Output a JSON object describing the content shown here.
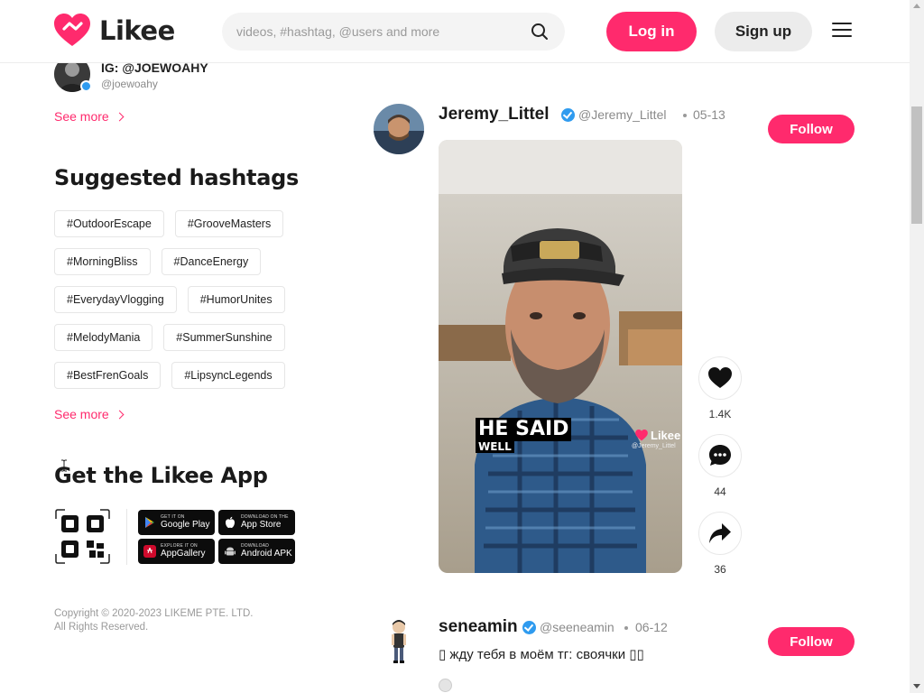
{
  "app": {
    "name": "Likee",
    "brand_color": "#ff2a6d"
  },
  "header": {
    "search_placeholder": "videos, #hashtag, @users and more",
    "login_label": "Log in",
    "signup_label": "Sign up"
  },
  "sidebar": {
    "account": {
      "name": "IG: @JOEWOAHY",
      "handle": "@joewoahy"
    },
    "see_more_1": "See more",
    "hashtags_title": "Suggested hashtags",
    "hashtags": [
      [
        "#OutdoorEscape",
        "#GrooveMasters"
      ],
      [
        "#MorningBliss",
        "#DanceEnergy"
      ],
      [
        "#EverydayVlogging",
        "#HumorUnites"
      ],
      [
        "#MelodyMania",
        "#SummerSunshine"
      ],
      [
        "#BestFrenGoals",
        "#LipsyncLegends"
      ]
    ],
    "see_more_2": "See more",
    "app_title": "Get the Likee App",
    "stores": [
      {
        "small": "GET IT ON",
        "big": "Google Play",
        "icon": "play-icon"
      },
      {
        "small": "DOWNLOAD ON THE",
        "big": "App Store",
        "icon": "apple-icon"
      },
      {
        "small": "EXPLORE IT ON",
        "big": "AppGallery",
        "icon": "huawei-icon"
      },
      {
        "small": "DOWNLOAD",
        "big": "Android APK",
        "icon": "android-icon"
      }
    ],
    "copyright_line1": "Copyright © 2020-2023 LIKEME PTE. LTD.",
    "copyright_line2": "All Rights Reserved."
  },
  "feed": {
    "posts": [
      {
        "name": "Jeremy_Littel",
        "handle": "@Jeremy_Littel",
        "date": "05-13",
        "follow_label": "Follow",
        "video": {
          "caption_big": "HE SAID",
          "caption_small": "WELL",
          "watermark": "Likee",
          "watermark_handle": "@Jeremy_Littel"
        },
        "likes": "1.4K",
        "comments": "44",
        "shares": "36"
      },
      {
        "name": "seneamin",
        "handle": "@seeneamin",
        "date": "06-12",
        "follow_label": "Follow",
        "caption": "▯ жду тебя в моём тг: своячки ▯▯"
      }
    ]
  }
}
